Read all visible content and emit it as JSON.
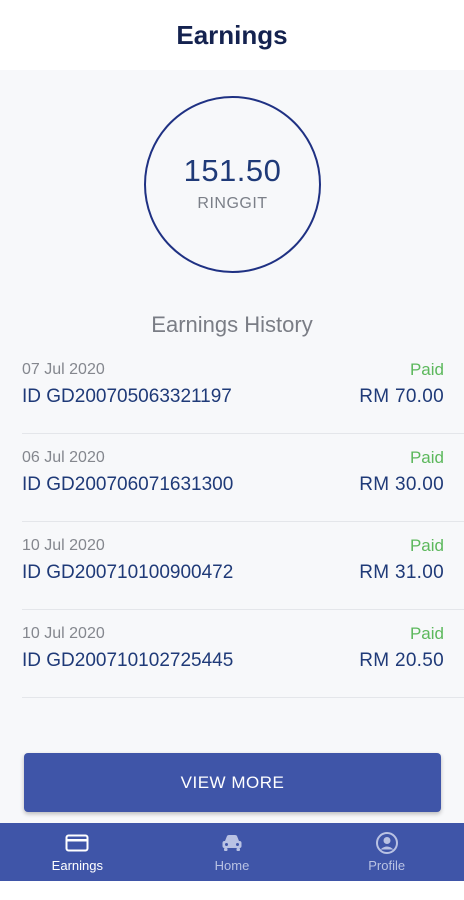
{
  "header": {
    "title": "Earnings"
  },
  "summary": {
    "amount": "151.50",
    "unit": "RINGGIT"
  },
  "history": {
    "title": "Earnings History",
    "items": [
      {
        "date": "07 Jul 2020",
        "id": "ID GD200705063321197",
        "status": "Paid",
        "amount": "RM 70.00"
      },
      {
        "date": "06 Jul 2020",
        "id": "ID GD200706071631300",
        "status": "Paid",
        "amount": "RM 30.00"
      },
      {
        "date": "10 Jul 2020",
        "id": "ID GD200710100900472",
        "status": "Paid",
        "amount": "RM 31.00"
      },
      {
        "date": "10 Jul 2020",
        "id": "ID GD200710102725445",
        "status": "Paid",
        "amount": "RM 20.50"
      }
    ]
  },
  "actions": {
    "view_more": "VIEW MORE"
  },
  "tabs": [
    {
      "label": "Earnings",
      "icon": "card-icon",
      "active": true
    },
    {
      "label": "Home",
      "icon": "car-icon",
      "active": false
    },
    {
      "label": "Profile",
      "icon": "user-circle-icon",
      "active": false
    }
  ],
  "colors": {
    "primary": "#3f55a8",
    "text_dark": "#1f3a78",
    "paid": "#5cb85c",
    "muted": "#84878e"
  }
}
